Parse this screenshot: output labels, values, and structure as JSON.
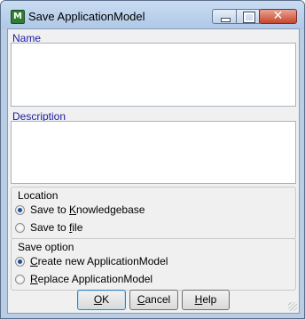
{
  "window": {
    "title": "Save ApplicationModel",
    "app_icon_letter": "M"
  },
  "fields": {
    "name_label": "Name",
    "name_value": "",
    "description_label": "Description",
    "description_value": ""
  },
  "location": {
    "title": "Location",
    "options": [
      {
        "label_prefix": "Save to ",
        "label_underlined": "K",
        "label_suffix": "nowledgebase",
        "checked": true
      },
      {
        "label_prefix": "Save to ",
        "label_underlined": "f",
        "label_suffix": "ile",
        "checked": false
      }
    ]
  },
  "save_option": {
    "title": "Save option",
    "options": [
      {
        "label_prefix": "",
        "label_underlined": "C",
        "label_suffix": "reate new ApplicationModel",
        "checked": true
      },
      {
        "label_prefix": "",
        "label_underlined": "R",
        "label_suffix": "eplace ApplicationModel",
        "checked": false
      }
    ]
  },
  "buttons": {
    "ok_u": "O",
    "ok_rest": "K",
    "cancel_u": "C",
    "cancel_rest": "ancel",
    "help_u": "H",
    "help_rest": "elp"
  }
}
